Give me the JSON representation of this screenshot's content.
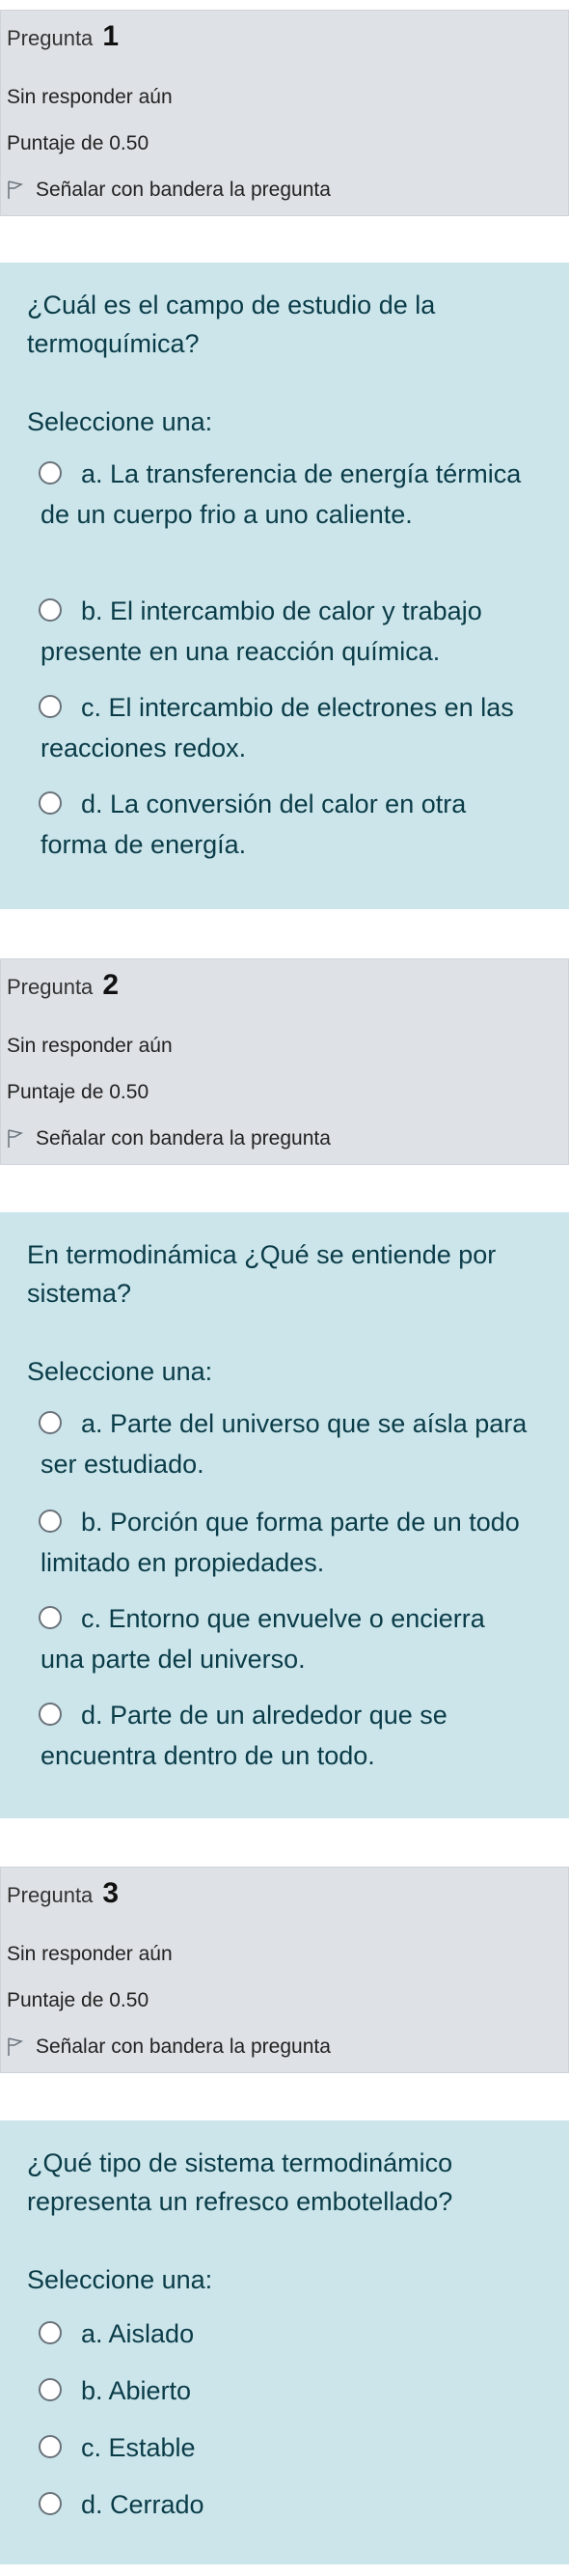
{
  "questions": [
    {
      "label": "Pregunta",
      "number": "1",
      "state": "Sin responder aún",
      "grade": "Puntaje de 0.50",
      "flag": "Señalar con bandera la pregunta",
      "text": "¿Cuál es el campo de estudio de la termoquímica?",
      "prompt": "Seleccione una:",
      "options": [
        "a. La transferencia de energía térmica de un cuerpo frio a uno caliente.",
        "b. El intercambio de calor y trabajo presente en una reacción química.",
        "c. El intercambio de electrones en las reacciones redox.",
        "d. La conversión del calor en otra forma de energía."
      ]
    },
    {
      "label": "Pregunta",
      "number": "2",
      "state": "Sin responder aún",
      "grade": "Puntaje de 0.50",
      "flag": "Señalar con bandera la pregunta",
      "text": "En termodinámica ¿Qué se entiende por sistema?",
      "prompt": "Seleccione una:",
      "options": [
        "a. Parte del universo que se aísla para ser estudiado.",
        "b. Porción que forma parte de un todo limitado en propiedades.",
        "c. Entorno que envuelve o encierra una parte del universo.",
        "d. Parte de un alrededor que se encuentra dentro de un todo."
      ]
    },
    {
      "label": "Pregunta",
      "number": "3",
      "state": "Sin responder aún",
      "grade": "Puntaje de 0.50",
      "flag": "Señalar con bandera la pregunta",
      "text": "¿Qué tipo de sistema termodinámico representa un refresco embotellado?",
      "prompt": "Seleccione una:",
      "options": [
        "a. Aislado",
        "b. Abierto",
        "c. Estable",
        "d. Cerrado"
      ]
    }
  ]
}
